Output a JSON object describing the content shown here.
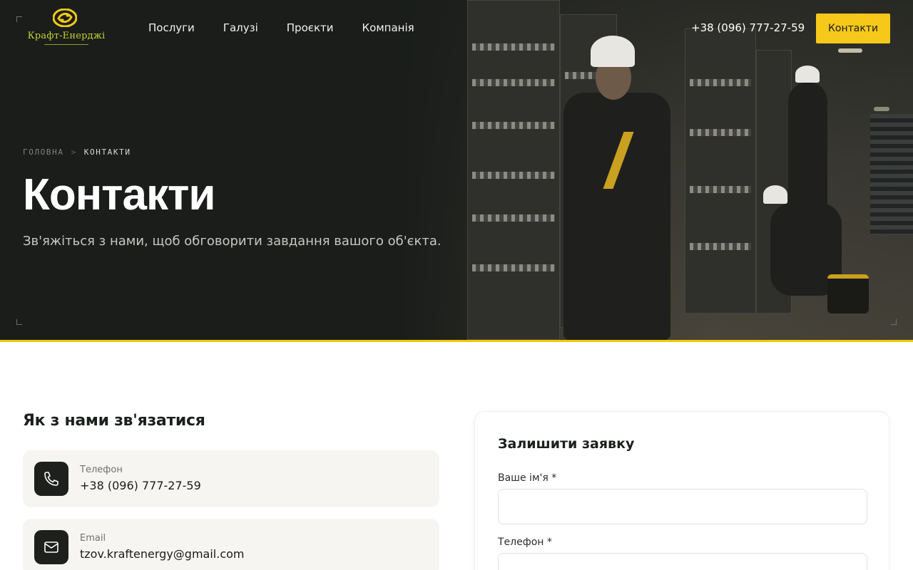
{
  "brand": {
    "name": "Крафт-Енерджі",
    "accent": "#f5c81a",
    "logo_color": "#c6d233"
  },
  "nav": {
    "items": [
      {
        "label": "Послуги"
      },
      {
        "label": "Галузі"
      },
      {
        "label": "Проєкти"
      },
      {
        "label": "Компанія"
      }
    ],
    "phone": "+38 (096) 777-27-59",
    "cta_label": "Контакти"
  },
  "breadcrumb": {
    "home": "ГОЛОВНА",
    "separator": ">",
    "current": "КОНТАКТИ"
  },
  "hero": {
    "title": "Контакти",
    "subtitle": "Зв'яжіться з нами, щоб обговорити завдання вашого об'єкта."
  },
  "contacts": {
    "title": "Як з нами зв'язатися",
    "items": [
      {
        "label": "Телефон",
        "value": "+38 (096) 777-27-59",
        "icon": "phone-icon"
      },
      {
        "label": "Email",
        "value": "tzov.kraftenergy@gmail.com",
        "icon": "mail-icon"
      }
    ]
  },
  "form": {
    "title": "Залишити заявку",
    "fields": [
      {
        "label": "Ваше ім'я *",
        "value": ""
      },
      {
        "label": "Телефон *",
        "value": ""
      }
    ]
  }
}
